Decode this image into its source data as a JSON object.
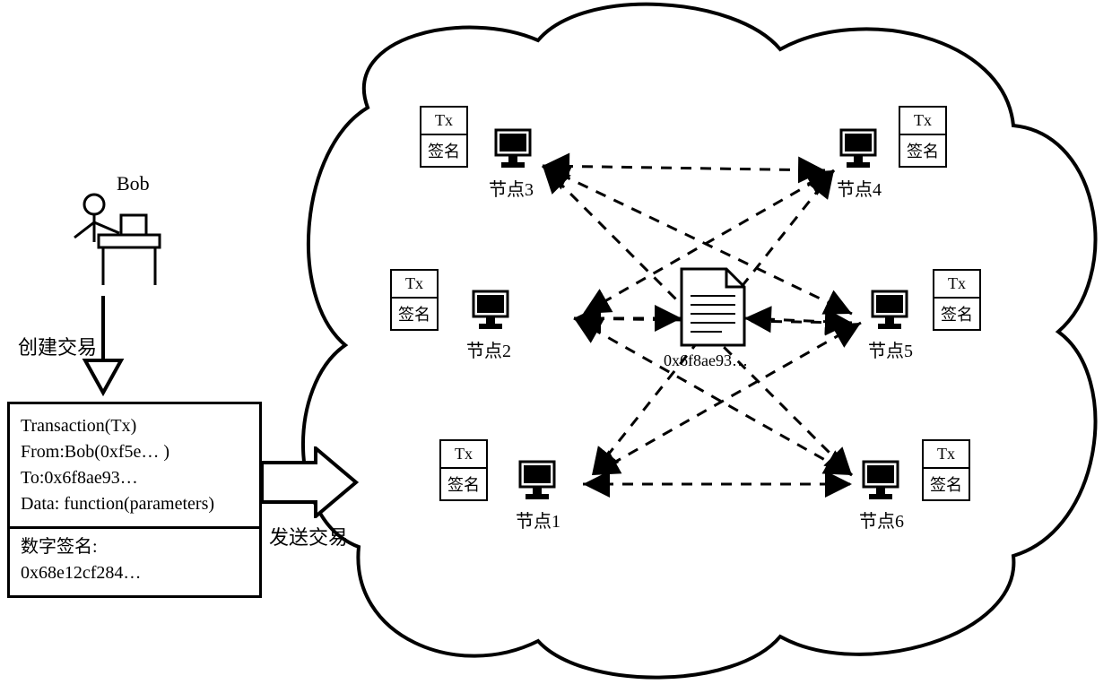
{
  "actor": {
    "name": "Bob"
  },
  "labels": {
    "create_tx": "创建交易",
    "send_tx": "发送交易"
  },
  "transaction": {
    "line1": "Transaction(Tx)",
    "line2": "From:Bob(0xf5e… )",
    "line3": "To:0x6f8ae93…",
    "line4": "Data: function(parameters)",
    "sig_label": "数字签名:",
    "sig_value": "0x68e12cf284…"
  },
  "tx_cell": {
    "top": "Tx",
    "bottom": "签名"
  },
  "contract_addr": "0x6f8ae93…",
  "nodes": {
    "n1": "节点1",
    "n2": "节点2",
    "n3": "节点3",
    "n4": "节点4",
    "n5": "节点5",
    "n6": "节点6"
  }
}
